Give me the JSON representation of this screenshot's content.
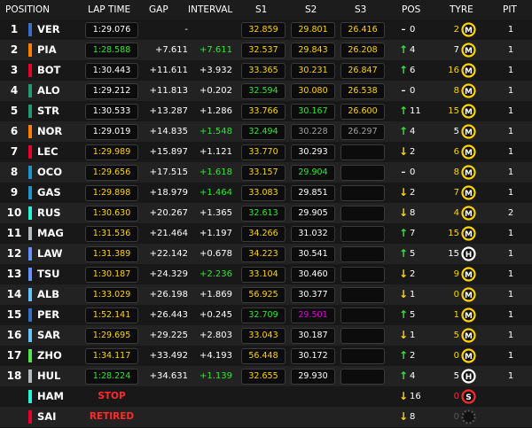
{
  "colors": {
    "white": "#ffffff",
    "yellow": "#ffd400",
    "green": "#2ee82e",
    "purple": "#e000e0",
    "grey": "#a0a0a0",
    "red": "#ff2a2a",
    "dim": "#555555"
  },
  "header": [
    "POSITION",
    "LAP TIME",
    "GAP",
    "INTERVAL",
    "S1",
    "S2",
    "S3",
    "POS",
    "TYRE",
    "PIT"
  ],
  "rows": [
    {
      "pos": "1",
      "code": "VER",
      "team": "#3671c6",
      "lap": "1:29.076",
      "lap_c": "white",
      "gap": "-",
      "gap_c": "white",
      "int": "",
      "int_c": "white",
      "s1": "32.859",
      "s1_c": "yellow",
      "s2": "29.801",
      "s2_c": "yellow",
      "s3": "26.416",
      "s3_c": "yellow",
      "arrow": "dash",
      "arrow_icon": "dash-icon",
      "pchg": "0",
      "tage": "2",
      "tage_c": "yellow",
      "tyre": "M",
      "tyre_icon": "tyre-medium-icon",
      "pit": "1"
    },
    {
      "pos": "2",
      "code": "PIA",
      "team": "#ff8000",
      "lap": "1:28.588",
      "lap_c": "green",
      "gap": "+7.611",
      "gap_c": "white",
      "int": "+7.611",
      "int_c": "green",
      "s1": "32.537",
      "s1_c": "yellow",
      "s2": "29.843",
      "s2_c": "yellow",
      "s3": "26.208",
      "s3_c": "yellow",
      "arrow": "up",
      "arrow_icon": "arrow-up-icon",
      "pchg": "4",
      "tage": "7",
      "tage_c": "white",
      "tyre": "M",
      "tyre_icon": "tyre-medium-icon",
      "pit": "1"
    },
    {
      "pos": "3",
      "code": "BOT",
      "team": "#e8002d",
      "lap": "1:30.443",
      "lap_c": "white",
      "gap": "+11.611",
      "gap_c": "white",
      "int": "+3.932",
      "int_c": "white",
      "s1": "33.365",
      "s1_c": "yellow",
      "s2": "30.231",
      "s2_c": "yellow",
      "s3": "26.847",
      "s3_c": "yellow",
      "arrow": "up",
      "arrow_icon": "arrow-up-icon",
      "pchg": "6",
      "tage": "16",
      "tage_c": "yellow",
      "tyre": "M",
      "tyre_icon": "tyre-medium-icon",
      "pit": "1"
    },
    {
      "pos": "4",
      "code": "ALO",
      "team": "#229971",
      "lap": "1:29.212",
      "lap_c": "white",
      "gap": "+11.813",
      "gap_c": "white",
      "int": "+0.202",
      "int_c": "white",
      "s1": "32.594",
      "s1_c": "green",
      "s2": "30.080",
      "s2_c": "yellow",
      "s3": "26.538",
      "s3_c": "yellow",
      "arrow": "dash",
      "arrow_icon": "dash-icon",
      "pchg": "0",
      "tage": "8",
      "tage_c": "yellow",
      "tyre": "M",
      "tyre_icon": "tyre-medium-icon",
      "pit": "1"
    },
    {
      "pos": "5",
      "code": "STR",
      "team": "#229971",
      "lap": "1:30.533",
      "lap_c": "white",
      "gap": "+13.287",
      "gap_c": "white",
      "int": "+1.286",
      "int_c": "white",
      "s1": "33.766",
      "s1_c": "yellow",
      "s2": "30.167",
      "s2_c": "green",
      "s3": "26.600",
      "s3_c": "yellow",
      "arrow": "up",
      "arrow_icon": "arrow-up-icon",
      "pchg": "11",
      "tage": "15",
      "tage_c": "yellow",
      "tyre": "M",
      "tyre_icon": "tyre-medium-icon",
      "pit": "1"
    },
    {
      "pos": "6",
      "code": "NOR",
      "team": "#ff8000",
      "lap": "1:29.019",
      "lap_c": "white",
      "gap": "+14.835",
      "gap_c": "white",
      "int": "+1.548",
      "int_c": "green",
      "s1": "32.494",
      "s1_c": "green",
      "s2": "30.228",
      "s2_c": "grey",
      "s3": "26.297",
      "s3_c": "grey",
      "arrow": "up",
      "arrow_icon": "arrow-up-icon",
      "pchg": "4",
      "tage": "5",
      "tage_c": "white",
      "tyre": "M",
      "tyre_icon": "tyre-medium-icon",
      "pit": "1"
    },
    {
      "pos": "7",
      "code": "LEC",
      "team": "#e8002d",
      "lap": "1:29.989",
      "lap_c": "yellow",
      "gap": "+15.897",
      "gap_c": "white",
      "int": "+1.121",
      "int_c": "white",
      "s1": "33.770",
      "s1_c": "yellow",
      "s2": "30.293",
      "s2_c": "white",
      "s3": "",
      "s3_c": "white",
      "arrow": "down",
      "arrow_icon": "arrow-down-icon",
      "pchg": "2",
      "tage": "6",
      "tage_c": "yellow",
      "tyre": "M",
      "tyre_icon": "tyre-medium-icon",
      "pit": "1"
    },
    {
      "pos": "8",
      "code": "OCO",
      "team": "#2293d1",
      "lap": "1:29.656",
      "lap_c": "yellow",
      "gap": "+17.515",
      "gap_c": "white",
      "int": "+1.618",
      "int_c": "green",
      "s1": "33.157",
      "s1_c": "yellow",
      "s2": "29.904",
      "s2_c": "green",
      "s3": "",
      "s3_c": "white",
      "arrow": "dash",
      "arrow_icon": "dash-icon",
      "pchg": "0",
      "tage": "8",
      "tage_c": "yellow",
      "tyre": "M",
      "tyre_icon": "tyre-medium-icon",
      "pit": "1"
    },
    {
      "pos": "9",
      "code": "GAS",
      "team": "#2293d1",
      "lap": "1:29.898",
      "lap_c": "yellow",
      "gap": "+18.979",
      "gap_c": "white",
      "int": "+1.464",
      "int_c": "green",
      "s1": "33.083",
      "s1_c": "yellow",
      "s2": "29.851",
      "s2_c": "white",
      "s3": "",
      "s3_c": "white",
      "arrow": "down",
      "arrow_icon": "arrow-down-icon",
      "pchg": "2",
      "tage": "7",
      "tage_c": "yellow",
      "tyre": "M",
      "tyre_icon": "tyre-medium-icon",
      "pit": "1"
    },
    {
      "pos": "10",
      "code": "RUS",
      "team": "#27f4d2",
      "lap": "1:30.630",
      "lap_c": "yellow",
      "gap": "+20.267",
      "gap_c": "white",
      "int": "+1.365",
      "int_c": "white",
      "s1": "32.613",
      "s1_c": "green",
      "s2": "29.905",
      "s2_c": "white",
      "s3": "",
      "s3_c": "white",
      "arrow": "down",
      "arrow_icon": "arrow-down-icon",
      "pchg": "8",
      "tage": "4",
      "tage_c": "yellow",
      "tyre": "M",
      "tyre_icon": "tyre-medium-icon",
      "pit": "2"
    },
    {
      "pos": "11",
      "code": "MAG",
      "team": "#b6babd",
      "lap": "1:31.536",
      "lap_c": "yellow",
      "gap": "+21.464",
      "gap_c": "white",
      "int": "+1.197",
      "int_c": "white",
      "s1": "34.266",
      "s1_c": "yellow",
      "s2": "31.032",
      "s2_c": "white",
      "s3": "",
      "s3_c": "white",
      "arrow": "up",
      "arrow_icon": "arrow-up-icon",
      "pchg": "7",
      "tage": "15",
      "tage_c": "yellow",
      "tyre": "M",
      "tyre_icon": "tyre-medium-icon",
      "pit": "1"
    },
    {
      "pos": "12",
      "code": "LAW",
      "team": "#6692ff",
      "lap": "1:31.389",
      "lap_c": "yellow",
      "gap": "+22.142",
      "gap_c": "white",
      "int": "+0.678",
      "int_c": "white",
      "s1": "34.223",
      "s1_c": "yellow",
      "s2": "30.541",
      "s2_c": "white",
      "s3": "",
      "s3_c": "white",
      "arrow": "up",
      "arrow_icon": "arrow-up-icon",
      "pchg": "5",
      "tage": "15",
      "tage_c": "white",
      "tyre": "H",
      "tyre_icon": "tyre-hard-icon",
      "pit": "1"
    },
    {
      "pos": "13",
      "code": "TSU",
      "team": "#6692ff",
      "lap": "1:30.187",
      "lap_c": "yellow",
      "gap": "+24.329",
      "gap_c": "white",
      "int": "+2.236",
      "int_c": "green",
      "s1": "33.104",
      "s1_c": "yellow",
      "s2": "30.460",
      "s2_c": "white",
      "s3": "",
      "s3_c": "white",
      "arrow": "down",
      "arrow_icon": "arrow-down-icon",
      "pchg": "2",
      "tage": "9",
      "tage_c": "yellow",
      "tyre": "M",
      "tyre_icon": "tyre-medium-icon",
      "pit": "1"
    },
    {
      "pos": "14",
      "code": "ALB",
      "team": "#64c4ff",
      "lap": "1:33.029",
      "lap_c": "yellow",
      "gap": "+26.198",
      "gap_c": "white",
      "int": "+1.869",
      "int_c": "white",
      "s1": "56.925",
      "s1_c": "yellow",
      "s2": "30.377",
      "s2_c": "white",
      "s3": "",
      "s3_c": "white",
      "arrow": "down",
      "arrow_icon": "arrow-down-icon",
      "pchg": "1",
      "tage": "0",
      "tage_c": "yellow",
      "tyre": "M",
      "tyre_icon": "tyre-medium-icon",
      "pit": "1"
    },
    {
      "pos": "15",
      "code": "PER",
      "team": "#3671c6",
      "lap": "1:52.141",
      "lap_c": "yellow",
      "gap": "+26.443",
      "gap_c": "white",
      "int": "+0.245",
      "int_c": "white",
      "s1": "32.709",
      "s1_c": "green",
      "s2": "29.501",
      "s2_c": "purple",
      "s3": "",
      "s3_c": "white",
      "arrow": "up",
      "arrow_icon": "arrow-up-icon",
      "pchg": "5",
      "tage": "1",
      "tage_c": "yellow",
      "tyre": "M",
      "tyre_icon": "tyre-medium-icon",
      "pit": "1"
    },
    {
      "pos": "16",
      "code": "SAR",
      "team": "#64c4ff",
      "lap": "1:29.695",
      "lap_c": "yellow",
      "gap": "+29.225",
      "gap_c": "white",
      "int": "+2.803",
      "int_c": "white",
      "s1": "33.043",
      "s1_c": "yellow",
      "s2": "30.187",
      "s2_c": "white",
      "s3": "",
      "s3_c": "white",
      "arrow": "down",
      "arrow_icon": "arrow-down-icon",
      "pchg": "1",
      "tage": "5",
      "tage_c": "yellow",
      "tyre": "M",
      "tyre_icon": "tyre-medium-icon",
      "pit": "1"
    },
    {
      "pos": "17",
      "code": "ZHO",
      "team": "#52e252",
      "lap": "1:34.117",
      "lap_c": "yellow",
      "gap": "+33.492",
      "gap_c": "white",
      "int": "+4.193",
      "int_c": "white",
      "s1": "56.448",
      "s1_c": "yellow",
      "s2": "30.172",
      "s2_c": "white",
      "s3": "",
      "s3_c": "white",
      "arrow": "up",
      "arrow_icon": "arrow-up-icon",
      "pchg": "2",
      "tage": "0",
      "tage_c": "yellow",
      "tyre": "M",
      "tyre_icon": "tyre-medium-icon",
      "pit": "1"
    },
    {
      "pos": "18",
      "code": "HUL",
      "team": "#b6babd",
      "lap": "1:28.224",
      "lap_c": "green",
      "gap": "+34.631",
      "gap_c": "white",
      "int": "+1.139",
      "int_c": "green",
      "s1": "32.655",
      "s1_c": "yellow",
      "s2": "29.930",
      "s2_c": "white",
      "s3": "",
      "s3_c": "white",
      "arrow": "up",
      "arrow_icon": "arrow-up-icon",
      "pchg": "4",
      "tage": "5",
      "tage_c": "white",
      "tyre": "H",
      "tyre_icon": "tyre-hard-icon",
      "pit": "1"
    },
    {
      "pos": "",
      "code": "HAM",
      "team": "#27f4d2",
      "status": "STOP",
      "arrow": "down",
      "arrow_icon": "arrow-down-icon",
      "pchg": "16",
      "tage": "0",
      "tage_c": "red",
      "tyre": "S",
      "tyre_icon": "tyre-soft-icon",
      "pit": ""
    },
    {
      "pos": "",
      "code": "SAI",
      "team": "#e8002d",
      "status": "RETIRED",
      "arrow": "down",
      "arrow_icon": "arrow-down-icon",
      "pchg": "8",
      "tage": "0",
      "tage_c": "dim",
      "tyre": "",
      "tyre_icon": "tyre-empty-icon",
      "pit": ""
    }
  ]
}
